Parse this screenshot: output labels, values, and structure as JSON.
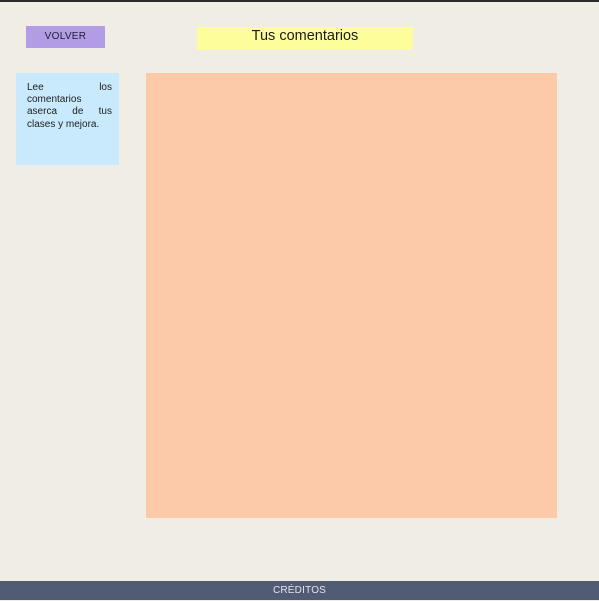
{
  "header": {
    "back_label": "VOLVER",
    "title": "Tus comentarios"
  },
  "sidebar": {
    "info_text": "Lee los comentarios aserca de tus clases y mejora."
  },
  "footer": {
    "credits_label": "CRÉDITOS"
  },
  "colors": {
    "page_background": "#f0eee4",
    "back_button": "#b39ce6",
    "title_banner": "#fdfd9b",
    "info_panel": "#c9eafc",
    "comments_area": "#fccaa8",
    "footer": "#525b74"
  }
}
